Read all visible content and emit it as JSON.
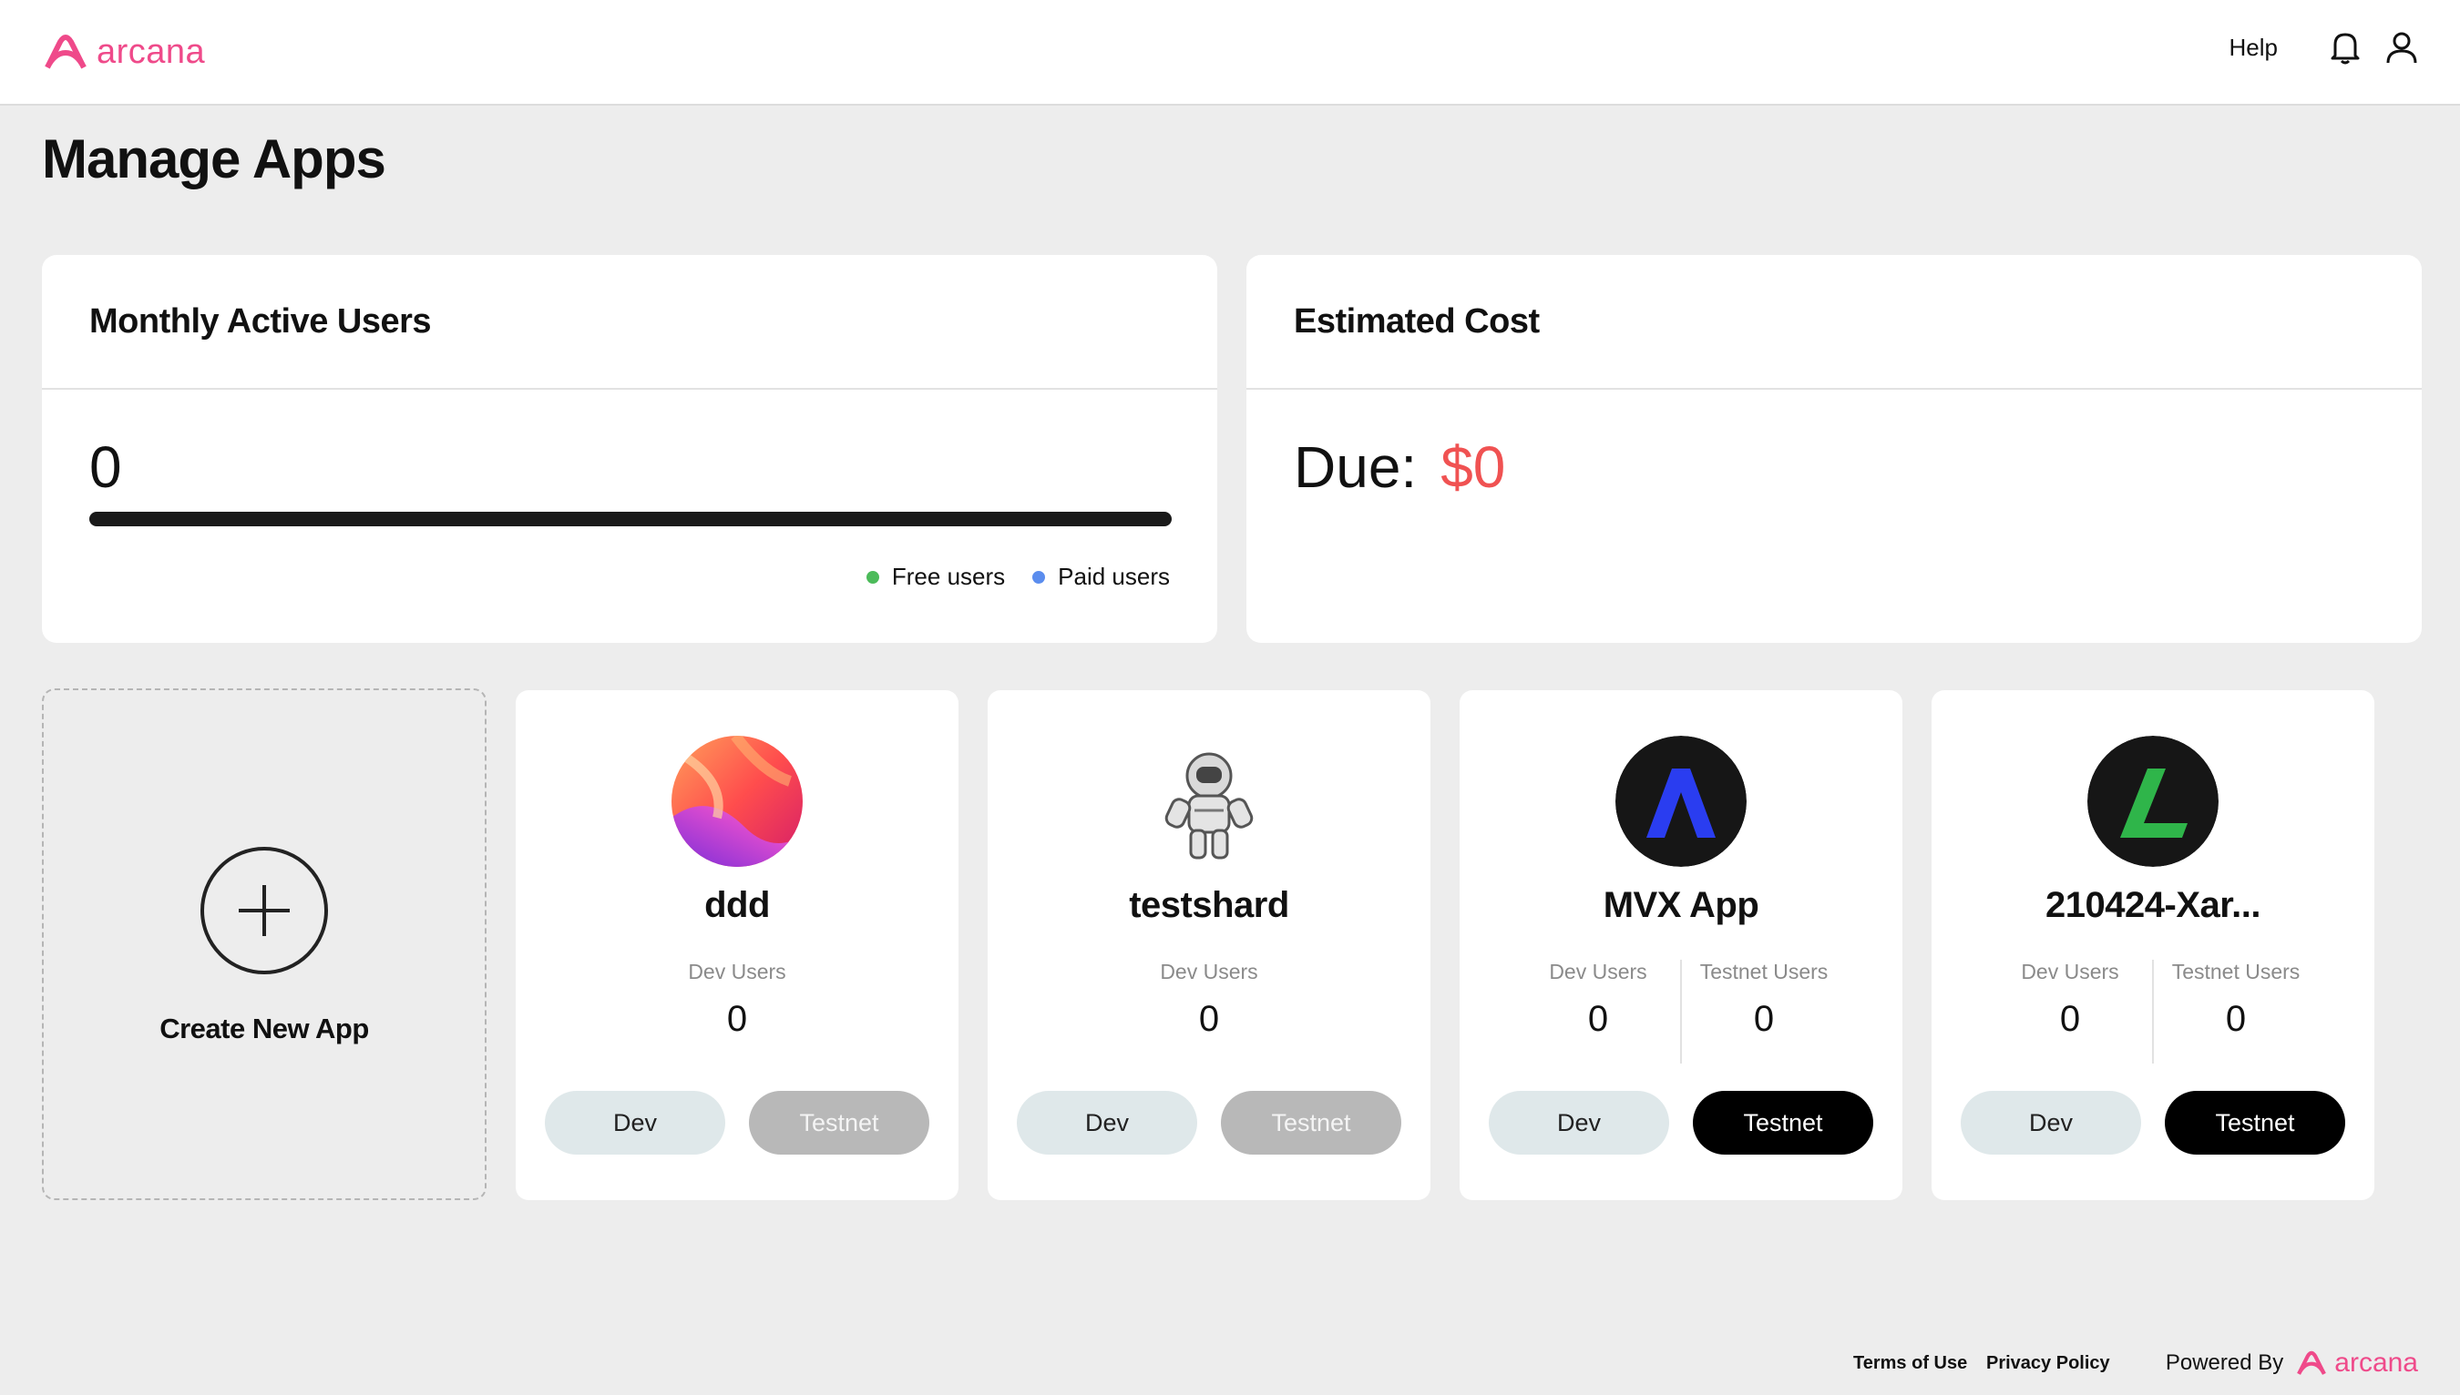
{
  "brand": {
    "name": "arcana",
    "color": "#ef4a8a"
  },
  "header": {
    "help": "Help",
    "icons": [
      "bell-icon",
      "user-icon"
    ]
  },
  "page": {
    "title": "Manage Apps"
  },
  "mau": {
    "title": "Monthly Active Users",
    "value": "0",
    "legend": [
      {
        "label": "Free users",
        "color": "#4cbb5a"
      },
      {
        "label": "Paid users",
        "color": "#5b8dee"
      }
    ]
  },
  "cost": {
    "title": "Estimated Cost",
    "due_label": "Due:",
    "due_value": "$0",
    "due_color": "#f05252"
  },
  "create": {
    "label": "Create New App",
    "icon": "plus-circle-icon"
  },
  "apps": [
    {
      "name": "ddd",
      "logo": "gradient-wave-logo",
      "stats": [
        {
          "label": "Dev Users",
          "value": "0"
        }
      ],
      "dev_label": "Dev",
      "testnet_label": "Testnet",
      "testnet_enabled": false
    },
    {
      "name": "testshard",
      "logo": "astronaut-logo",
      "stats": [
        {
          "label": "Dev Users",
          "value": "0"
        }
      ],
      "dev_label": "Dev",
      "testnet_label": "Testnet",
      "testnet_enabled": false
    },
    {
      "name": "MVX App",
      "logo": "mvx-logo",
      "stats": [
        {
          "label": "Dev Users",
          "value": "0"
        },
        {
          "label": "Testnet Users",
          "value": "0"
        }
      ],
      "dev_label": "Dev",
      "testnet_label": "Testnet",
      "testnet_enabled": true
    },
    {
      "name": "210424-Xar...",
      "logo": "green-l-logo",
      "stats": [
        {
          "label": "Dev Users",
          "value": "0"
        },
        {
          "label": "Testnet Users",
          "value": "0"
        }
      ],
      "dev_label": "Dev",
      "testnet_label": "Testnet",
      "testnet_enabled": true
    }
  ],
  "footer": {
    "terms": "Terms of Use",
    "privacy": "Privacy Policy",
    "powered_by": "Powered By",
    "brand": "arcana"
  }
}
